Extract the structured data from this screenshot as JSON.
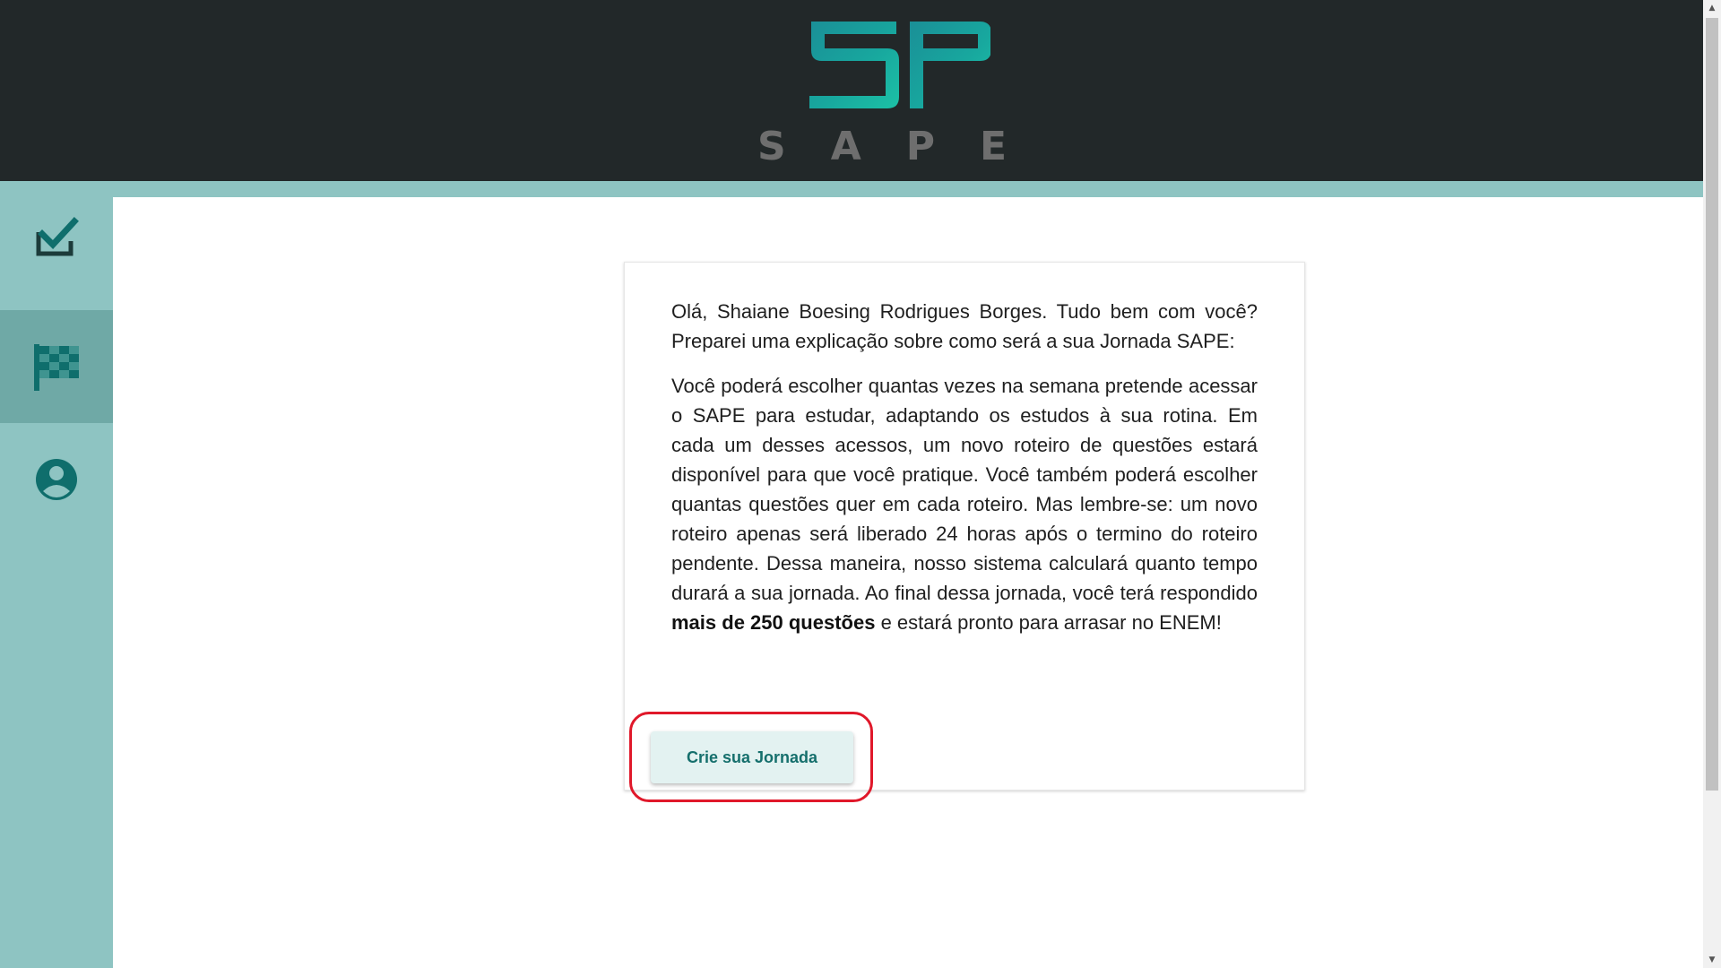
{
  "app": {
    "logo_wordmark": "SAPE"
  },
  "sidebar": {
    "items": [
      {
        "name": "check-icon",
        "active": false
      },
      {
        "name": "checkered-flag-icon",
        "active": true
      },
      {
        "name": "user-account-icon",
        "active": false
      }
    ]
  },
  "card": {
    "greeting": "Olá, Shaiane Boesing Rodrigues Borges. Tudo bem com você? Preparei uma explicação sobre como será a sua Jornada SAPE:",
    "body_before_bold": "Você poderá escolher quantas vezes na semana pretende acessar o SAPE para estudar, adaptando os estudos à sua rotina. Em cada um desses acessos, um novo roteiro de questões estará disponível para que você pratique. Você também poderá escolher quantas questões quer em cada roteiro. Mas lembre-se: um novo roteiro apenas será liberado 24 horas após o termino do roteiro pendente. Dessa maneira, nosso sistema calculará quanto tempo durará a sua jornada. Ao final dessa jornada, você terá respondido ",
    "body_bold": "mais de 250 questões",
    "body_after_bold": " e estará pronto para arrasar no ENEM!",
    "cta_label": "Crie sua Jornada"
  },
  "colors": {
    "header_bg": "#222829",
    "accent_teal": "#8ec4c2",
    "active_nav": "#6fa9a6",
    "icon_dark_teal": "#0f6e6c",
    "cta_text": "#156f6c",
    "highlight_ring": "#e0182a"
  },
  "scrollbar": {
    "up_arrow": "▲",
    "down_arrow": "▼"
  }
}
